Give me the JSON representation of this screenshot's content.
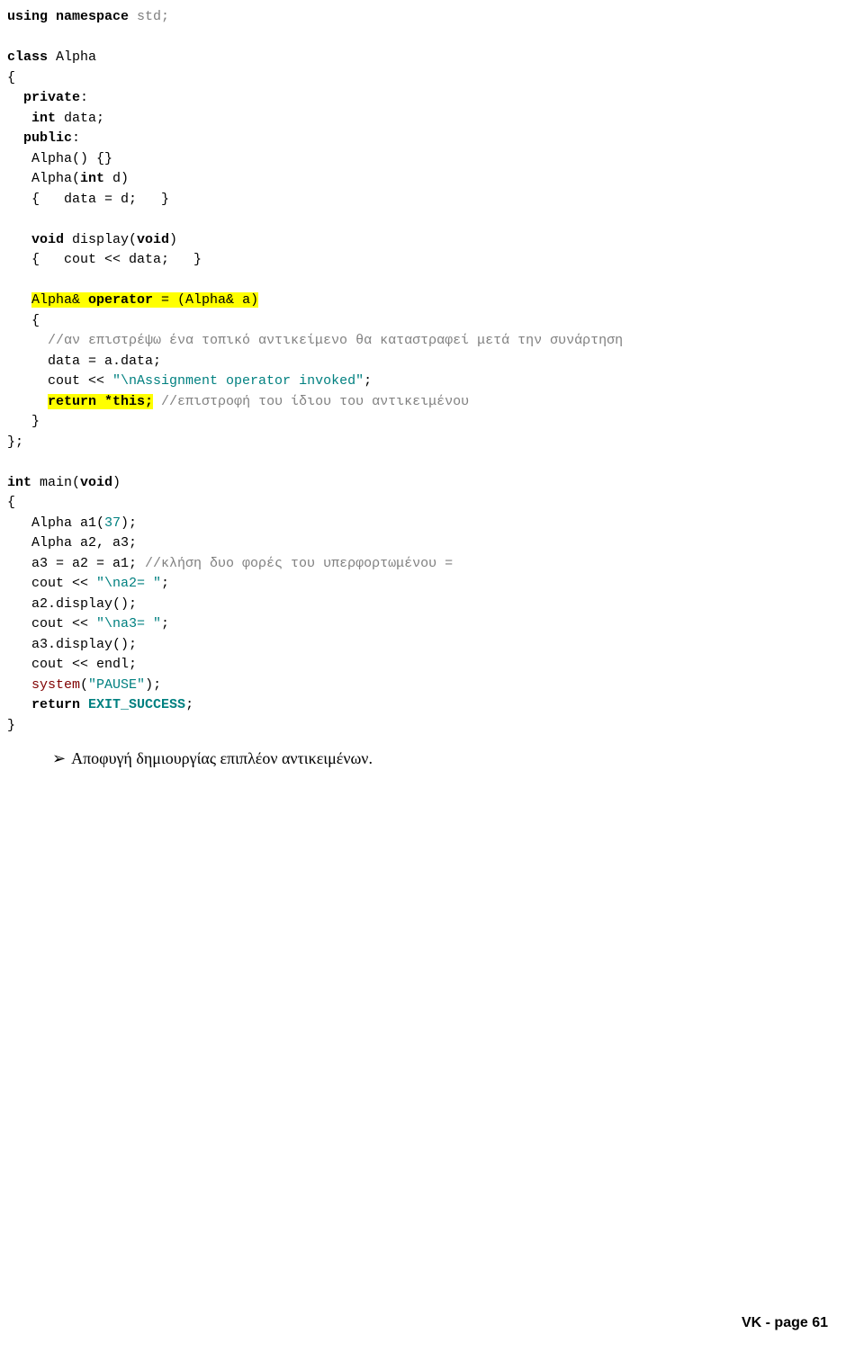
{
  "code": {
    "l1_using": "using namespace",
    "l1_std": " std;",
    "l2_blank": "",
    "l3_class": "class",
    "l3_alpha": " Alpha",
    "l4": "{",
    "l5_private": "  private",
    "l5_colon": ":",
    "l6_int": "   int",
    "l6_data": " data;",
    "l7_public": "  public",
    "l7_colon": ":",
    "l8": "   Alpha() {}",
    "l9a": "   Alpha(",
    "l9b": "int",
    "l9c": " d)",
    "l10": "   {   data = d;   }",
    "l11": "",
    "l12a": "   void",
    "l12b": " display(",
    "l12c": "void",
    "l12d": ")",
    "l13": "   {   cout << data;   }",
    "l14": "",
    "l15a": "   ",
    "l15b": "Alpha& ",
    "l15b2": "operator",
    "l15c": " = (Alpha& a)",
    "l16": "   {",
    "l17": "     //αν επιστρέψω ένα τοπικό αντικείμενο θα καταστραφεί μετά την συνάρτηση",
    "l18": "     data = a.data;",
    "l19a": "     cout << ",
    "l19b": "\"\\nAssignment operator invoked\"",
    "l19c": ";",
    "l20a": "     ",
    "l20b": "return *this;",
    "l20c": " //επιστροφή του ίδιου του αντικειμένου",
    "l21": "   }",
    "l22": "};",
    "l23": "",
    "l24a": "int",
    "l24b": " main(",
    "l24c": "void",
    "l24d": ")",
    "l25": "{",
    "l26a": "   Alpha a1(",
    "l26b": "37",
    "l26c": ");",
    "l27": "   Alpha a2, a3;",
    "l28a": "   a3 = a2 = a1; ",
    "l28b": "//κλήση δυο φορές του υπερφορτωμένου =",
    "l29a": "   cout << ",
    "l29b": "\"\\na2= \"",
    "l29c": ";",
    "l30": "   a2.display();",
    "l31a": "   cout << ",
    "l31b": "\"\\na3= \"",
    "l31c": ";",
    "l32": "   a3.display();",
    "l33": "   cout << endl;",
    "l34a": "   ",
    "l34b": "system",
    "l34c": "(",
    "l34d": "\"PAUSE\"",
    "l34e": ");",
    "l35a": "   return",
    "l35b": " ",
    "l35c": "EXIT_SUCCESS",
    "l35d": ";",
    "l36": "}"
  },
  "note": {
    "bullet": "➢",
    "text": "Αποφυγή δημιουργίας επιπλέον αντικειμένων."
  },
  "footer": "VK - page 61"
}
